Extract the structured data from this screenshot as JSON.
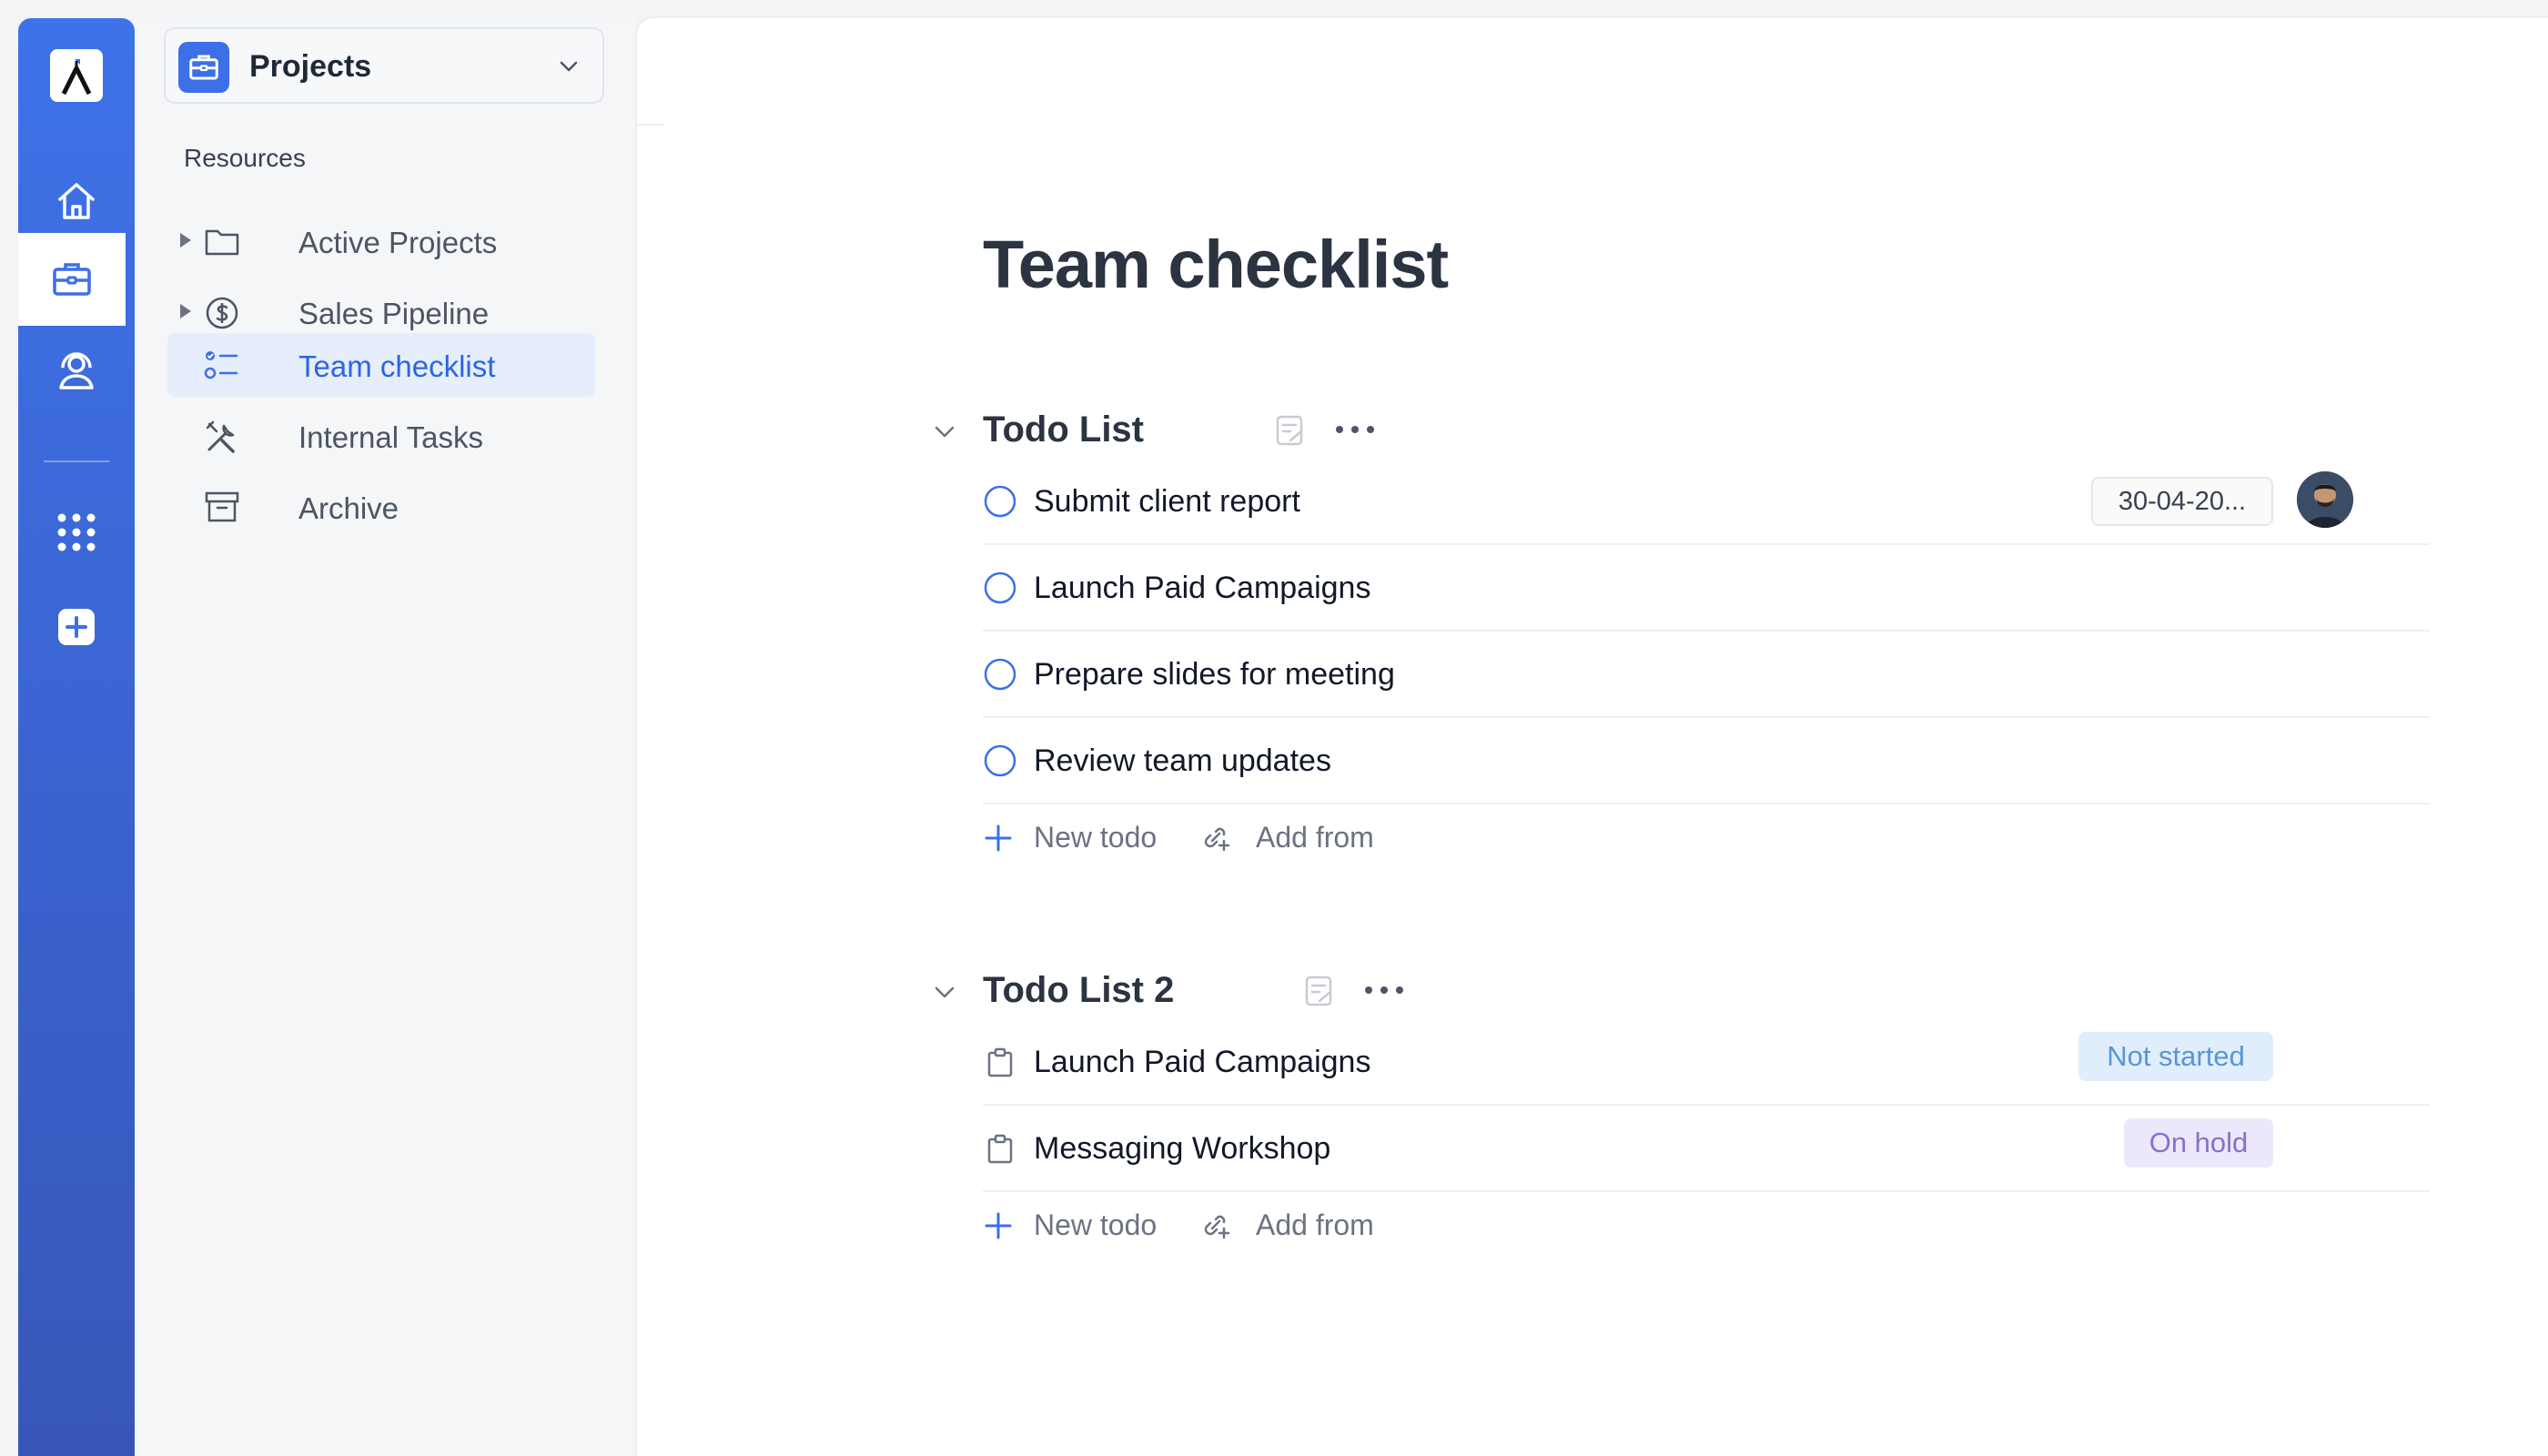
{
  "app": {
    "brand": "logo-a-icon",
    "colors": {
      "accent": "#3d6fe6",
      "rail_top": "#3e72e8",
      "rail_bottom": "#3856b8"
    }
  },
  "rail": {
    "items": [
      {
        "icon": "home-icon"
      },
      {
        "icon": "briefcase-icon",
        "active": true
      },
      {
        "icon": "contact-support-icon"
      },
      {
        "icon": "apps-grid-icon"
      },
      {
        "icon": "add-square-icon"
      }
    ]
  },
  "sidebar": {
    "workspace": {
      "title": "Projects",
      "icon": "briefcase-icon"
    },
    "section_label": "Resources",
    "items": [
      {
        "label": "Active Projects",
        "icon": "folder-icon",
        "expandable": true
      },
      {
        "label": "Sales Pipeline",
        "icon": "dollar-circle-icon",
        "expandable": true
      },
      {
        "label": "Team checklist",
        "icon": "checklist-icon",
        "active": true
      },
      {
        "label": "Internal Tasks",
        "icon": "tools-icon"
      },
      {
        "label": "Archive",
        "icon": "archive-box-icon"
      }
    ]
  },
  "main": {
    "title": "Team checklist",
    "lists": [
      {
        "title": "Todo List",
        "items": [
          {
            "text": "Submit client report",
            "date": "30-04-20...",
            "has_avatar": true
          },
          {
            "text": "Launch Paid Campaigns"
          },
          {
            "text": "Prepare slides for meeting"
          },
          {
            "text": "Review team updates"
          }
        ],
        "new_label": "New todo",
        "add_from_label": "Add from"
      },
      {
        "title": "Todo List 2",
        "items": [
          {
            "text": "Launch Paid Campaigns",
            "status": "Not started"
          },
          {
            "text": "Messaging Workshop",
            "status": "On hold"
          }
        ],
        "new_label": "New todo",
        "add_from_label": "Add from"
      }
    ]
  }
}
